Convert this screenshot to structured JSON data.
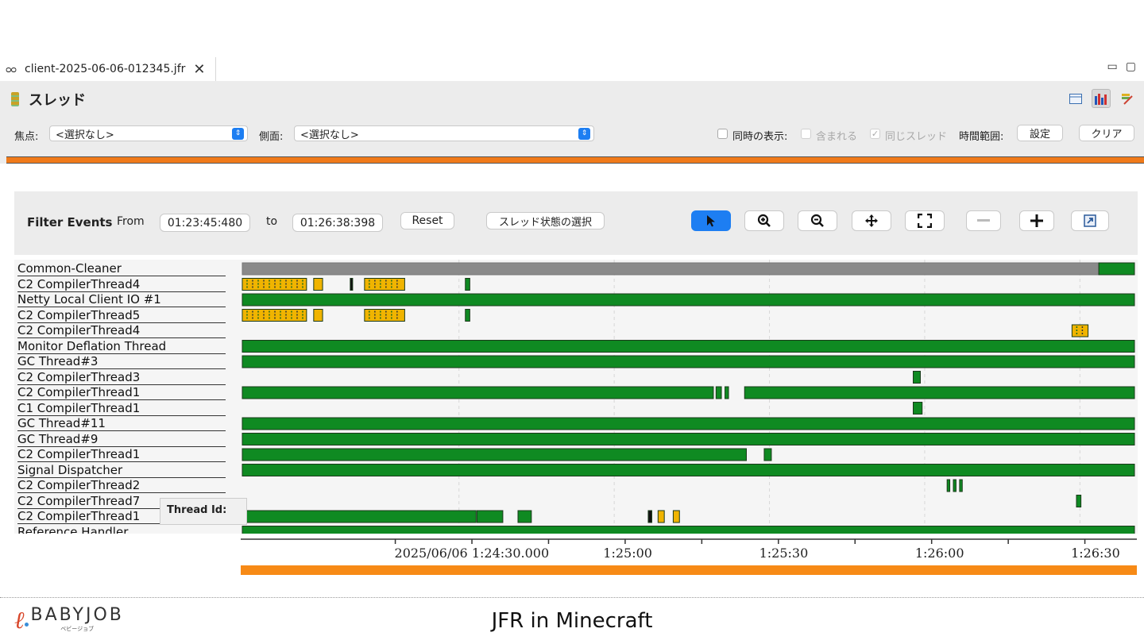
{
  "tab": {
    "icon": "recording-icon",
    "title": "client-2025-06-06-012345.jfr",
    "close": "✕"
  },
  "window_controls": {
    "minimize": "▭",
    "maximize": "▢"
  },
  "page": {
    "title": "スレッド",
    "icon": "thread-stack-icon"
  },
  "toolbar_icons": [
    "table-view-icon",
    "chart-view-icon",
    "edit-icon"
  ],
  "filters": {
    "focus_label": "焦点:",
    "focus_value": "<選択なし>",
    "side_label": "側面:",
    "side_value": "<選択なし>",
    "concurrent_label": "同時の表示:",
    "contained_label": "含まれる",
    "same_thread_label": "同じスレッド",
    "time_range_label": "時間範囲:",
    "set_button": "設定",
    "clear_button": "クリア"
  },
  "filter_panel": {
    "title": "Filter Events",
    "from_label": "From",
    "from_value": "01:23:45:480",
    "to_label": "to",
    "to_value": "01:26:38:398",
    "reset_button": "Reset",
    "state_button": "スレッド状態の選択",
    "tools": [
      "select-pointer-icon",
      "zoom-in-icon",
      "zoom-out-icon",
      "pan-icon",
      "fit-icon",
      "collapse-icon",
      "expand-icon",
      "export-icon"
    ]
  },
  "colors": {
    "running": "#0f8a22",
    "idle": "#8a8a8a",
    "compile": "#f0b400",
    "accent": "#f07a1a",
    "select": "#1d7ef2"
  },
  "threads": [
    {
      "name": "Common-Cleaner",
      "segments": [
        [
          0.0,
          0.96,
          "idle"
        ],
        [
          0.96,
          1.0,
          "running"
        ]
      ]
    },
    {
      "name": "C2 CompilerThread4",
      "segments": [
        [
          0.0,
          0.072,
          "compile"
        ],
        [
          0.08,
          0.09,
          "compile"
        ],
        [
          0.121,
          0.123,
          "black"
        ],
        [
          0.137,
          0.182,
          "compile"
        ],
        [
          0.25,
          0.255,
          "running"
        ]
      ]
    },
    {
      "name": "Netty Local Client IO #1",
      "segments": [
        [
          0.0,
          1.0,
          "running"
        ]
      ]
    },
    {
      "name": "C2 CompilerThread5",
      "segments": [
        [
          0.0,
          0.072,
          "compile"
        ],
        [
          0.08,
          0.09,
          "compile"
        ],
        [
          0.137,
          0.182,
          "compile"
        ],
        [
          0.25,
          0.255,
          "running"
        ]
      ]
    },
    {
      "name": "C2 CompilerThread4",
      "segments": [
        [
          0.93,
          0.948,
          "compile"
        ]
      ]
    },
    {
      "name": "Monitor Deflation Thread",
      "segments": [
        [
          0.0,
          1.0,
          "running"
        ]
      ]
    },
    {
      "name": "GC Thread#3",
      "segments": [
        [
          0.0,
          1.0,
          "running"
        ]
      ]
    },
    {
      "name": "C2 CompilerThread3",
      "segments": [
        [
          0.752,
          0.76,
          "running"
        ]
      ]
    },
    {
      "name": "C2 CompilerThread1",
      "segments": [
        [
          0.0,
          0.528,
          "running"
        ],
        [
          0.531,
          0.537,
          "running"
        ],
        [
          0.541,
          0.545,
          "running"
        ],
        [
          0.563,
          1.0,
          "running"
        ]
      ]
    },
    {
      "name": "C1 CompilerThread1",
      "segments": [
        [
          0.752,
          0.762,
          "running"
        ]
      ]
    },
    {
      "name": "GC Thread#11",
      "segments": [
        [
          0.0,
          1.0,
          "running"
        ]
      ]
    },
    {
      "name": "GC Thread#9",
      "segments": [
        [
          0.0,
          1.0,
          "running"
        ]
      ]
    },
    {
      "name": "C2 CompilerThread1",
      "segments": [
        [
          0.0,
          0.565,
          "running"
        ],
        [
          0.585,
          0.593,
          "running"
        ]
      ]
    },
    {
      "name": "Signal Dispatcher",
      "segments": [
        [
          0.0,
          1.0,
          "running"
        ]
      ]
    },
    {
      "name": "C2 CompilerThread2",
      "segments": [
        [
          0.79,
          0.793,
          "running"
        ],
        [
          0.797,
          0.8,
          "running"
        ],
        [
          0.804,
          0.807,
          "running"
        ]
      ]
    },
    {
      "name": "C2 CompilerThread7",
      "segments": [
        [
          0.935,
          0.94,
          "running"
        ]
      ]
    },
    {
      "name": "C2 CompilerThread1",
      "segments": [
        [
          0.0,
          0.262,
          "running"
        ],
        [
          0.263,
          0.292,
          "running"
        ],
        [
          0.309,
          0.324,
          "running"
        ],
        [
          0.455,
          0.459,
          "black"
        ],
        [
          0.466,
          0.473,
          "compile"
        ],
        [
          0.483,
          0.49,
          "compile"
        ]
      ]
    },
    {
      "name": "Reference Handler",
      "segments": [
        [
          0.0,
          1.0,
          "running"
        ]
      ]
    }
  ],
  "tooltip": {
    "label": "Thread Id:"
  },
  "axis": {
    "ticks": [
      {
        "label": "2025/06/06 1:24:30.000",
        "pos": 0.258
      },
      {
        "label": "1:25:00",
        "pos": 0.432
      },
      {
        "label": "1:25:30",
        "pos": 0.606
      },
      {
        "label": "1:26:00",
        "pos": 0.78
      },
      {
        "label": "1:26:30",
        "pos": 0.954
      }
    ]
  },
  "footer": {
    "logo_text": "BABYJOB",
    "logo_sub": "ベビージョブ",
    "title": "JFR in Minecraft"
  }
}
